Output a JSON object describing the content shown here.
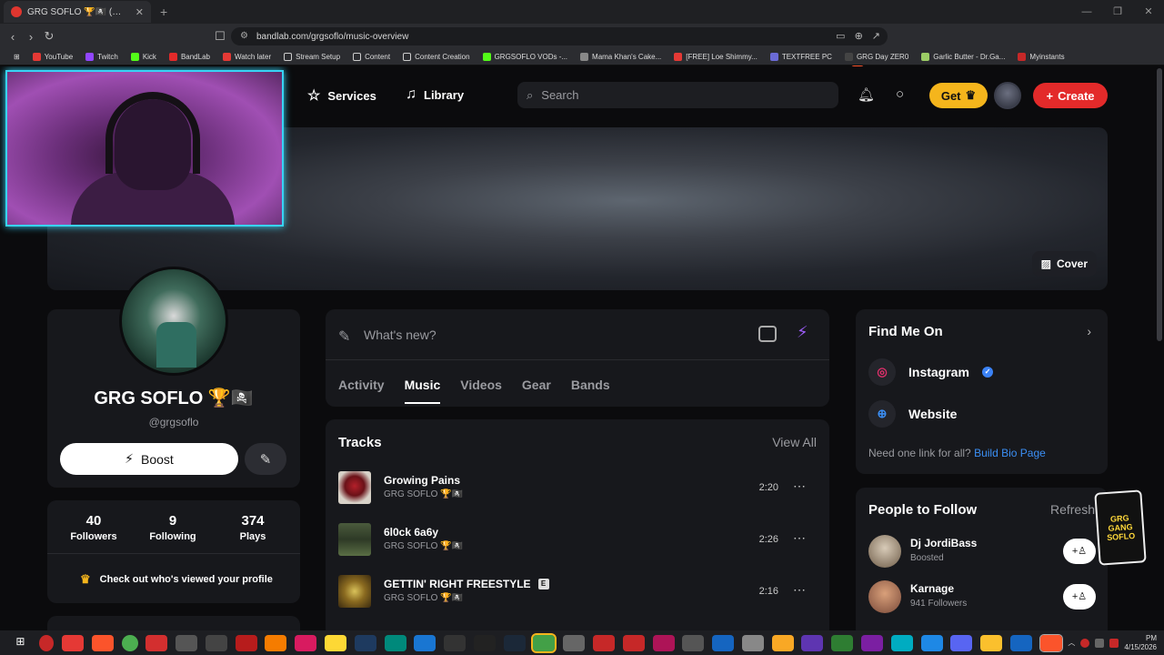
{
  "browser": {
    "tab_title": "GRG SOFLO 🏆🏴‍☠️ (@grgsoflo) -",
    "url": "bandlab.com/grgsoflo/music-overview",
    "bookmarks": [
      "YouTube",
      "Twitch",
      "Kick",
      "BandLab",
      "Watch later",
      "Stream Setup",
      "Content",
      "Content Creation",
      "GRGSOFLO VODs -...",
      "Mama Khan's Cake...",
      "[FREE] Loe Shimmy...",
      "TEXTFREE PC",
      "GRG Day ZER0",
      "Garlic Butter - Dr.Ga...",
      "Myinstants"
    ]
  },
  "nav": {
    "services": "Services",
    "library": "Library",
    "search_placeholder": "Search",
    "get": "Get",
    "create": "Create"
  },
  "cover": {
    "button": "Cover"
  },
  "profile": {
    "name": "GRG SOFLO 🏆🏴‍☠️",
    "handle": "@grgsoflo",
    "boost": "Boost",
    "stats": [
      {
        "value": "40",
        "label": "Followers"
      },
      {
        "value": "9",
        "label": "Following"
      },
      {
        "value": "374",
        "label": "Plays"
      }
    ],
    "viewed": "Check out who's viewed your profile"
  },
  "compose": {
    "placeholder": "What's new?",
    "tabs": [
      "Activity",
      "Music",
      "Videos",
      "Gear",
      "Bands"
    ],
    "active_tab": "Music"
  },
  "tracks": {
    "title": "Tracks",
    "view_all": "View All",
    "items": [
      {
        "title": "Growing Pains",
        "artist": "GRG SOFLO 🏆🏴‍☠️",
        "duration": "2:20",
        "explicit": false
      },
      {
        "title": "6l0ck 6a6y",
        "artist": "GRG SOFLO 🏆🏴‍☠️",
        "duration": "2:26",
        "explicit": false
      },
      {
        "title": "GETTIN' RIGHT FREESTYLE",
        "artist": "GRG SOFLO 🏆🏴‍☠️",
        "duration": "2:16",
        "explicit": true
      }
    ],
    "explicit_badge": "E"
  },
  "find_me": {
    "title": "Find Me On",
    "links": [
      "Instagram",
      "Website"
    ],
    "bio_text": "Need one link for all?",
    "bio_link": "Build Bio Page"
  },
  "people": {
    "title": "People to Follow",
    "refresh": "Refresh",
    "items": [
      {
        "name": "Dj JordiBass",
        "sub": "Boosted"
      },
      {
        "name": "Karnage",
        "sub": "941 Followers"
      }
    ]
  },
  "taskbar": {
    "time": "PM",
    "date": "4/15/2026"
  },
  "colors": {
    "accent_red": "#e32a2a",
    "accent_gold": "#f5b51c",
    "link_blue": "#3b8ff5"
  }
}
